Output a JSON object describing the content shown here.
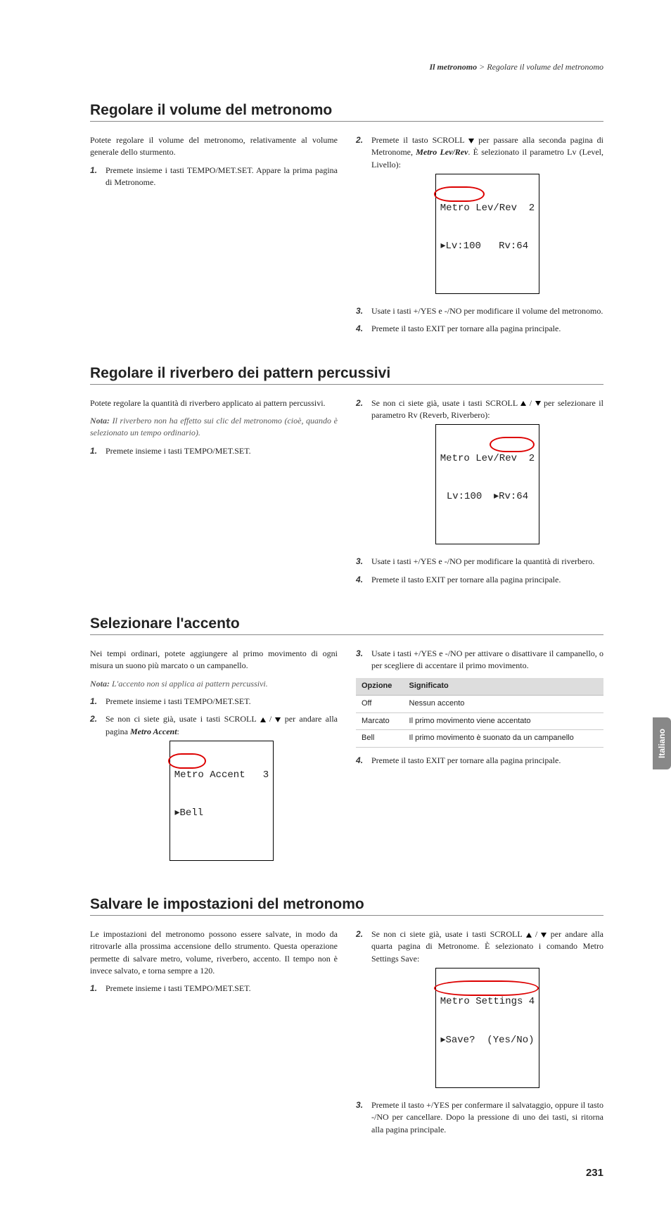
{
  "breadcrumb": {
    "section": "Il metronomo",
    "sep": " > ",
    "page": "Regolare il volume del metronomo"
  },
  "sideTab": "Italiano",
  "pageNumber": "231",
  "s1": {
    "title": "Regolare il volume del metronomo",
    "intro": "Potete regolare il volume del metronomo, relativamente al volume generale dello sturmento.",
    "step1": "Premete insieme i tasti TEMPO/MET.SET. Appare la prima pagina di Metronome.",
    "step2a": "Premete il tasto SCROLL ",
    "step2b": " per passare alla seconda pagina di Metronome, ",
    "step2_bold": "Metro Lev/Rev",
    "step2c": ". È selezionato il parametro Lv (Level, Livello):",
    "lcd1_l1": "Metro Lev/Rev  2",
    "lcd1_l2": "▸Lv:100   Rv:64 ",
    "step3": "Usate i tasti +/YES e -/NO per modificare il volume del metronomo.",
    "step4": "Premete il tasto EXIT per tornare alla pagina principale."
  },
  "s2": {
    "title": "Regolare il riverbero dei pattern percussivi",
    "intro": "Potete regolare la quantità di riverbero applicato ai pattern percussivi.",
    "noteLabel": "Nota:",
    "note": " Il riverbero non ha effetto sui clic del metronomo (cioè, quando è selezionato un tempo ordinario).",
    "step1": "Premete insieme i tasti TEMPO/MET.SET.",
    "step2a": "Se non ci siete già, usate i tasti SCROLL ",
    "step2b": " / ",
    "step2c": " per selezionare il parametro Rv (Reverb, Riverbero):",
    "lcd1_l1": "Metro Lev/Rev  2",
    "lcd1_l2": " Lv:100  ▸Rv:64 ",
    "step3": "Usate i tasti +/YES e -/NO per modificare la quantità di riverbero.",
    "step4": "Premete il tasto EXIT per tornare alla pagina principale."
  },
  "s3": {
    "title": "Selezionare l'accento",
    "intro": "Nei tempi ordinari, potete aggiungere al primo movimento di ogni misura un suono più marcato o un campanello.",
    "noteLabel": "Nota:",
    "note": " L'accento non si applica ai pattern percussivi.",
    "step1": "Premete insieme i tasti TEMPO/MET.SET.",
    "step2a": "Se non ci siete già, usate i tasti SCROLL ",
    "step2b": " / ",
    "step2c": " per andare alla pagina ",
    "step2_bold": "Metro Accent",
    "step2d": ":",
    "lcd1_l1": "Metro Accent   3",
    "lcd1_l2": "▸Bell           ",
    "step3": "Usate i tasti +/YES e -/NO per attivare o disattivare il campanello, o per scegliere di accentare il primo movimento.",
    "table": {
      "h1": "Opzione",
      "h2": "Significato",
      "r1c1": "Off",
      "r1c2": "Nessun accento",
      "r2c1": "Marcato",
      "r2c2": "Il primo movimento viene accentato",
      "r3c1": "Bell",
      "r3c2": "Il primo movimento è suonato da un campanello"
    },
    "step4": "Premete il tasto EXIT per tornare alla pagina principale."
  },
  "s4": {
    "title": "Salvare le impostazioni del metronomo",
    "intro": "Le impostazioni del metronomo possono essere salvate, in modo da ritrovarle alla prossima accensione dello strumento. Questa operazione permette di salvare metro, volume, riverbero, accento. Il tempo non è invece salvato, e torna sempre a 120.",
    "step1": "Premete insieme i tasti TEMPO/MET.SET.",
    "step2a": "Se non ci siete già, usate i tasti SCROLL ",
    "step2b": " / ",
    "step2c": " per andare alla quarta pagina di Metronome. È selezionato i comando Metro Settings Save:",
    "lcd1_l1": "Metro Settings 4",
    "lcd1_l2": "▸Save?  (Yes/No)",
    "step3": "Premete il tasto +/YES per confermare il salvataggio, oppure il tasto -/NO per cancellare. Dopo la pressione di uno dei tasti, si ritorna alla pagina principale."
  }
}
